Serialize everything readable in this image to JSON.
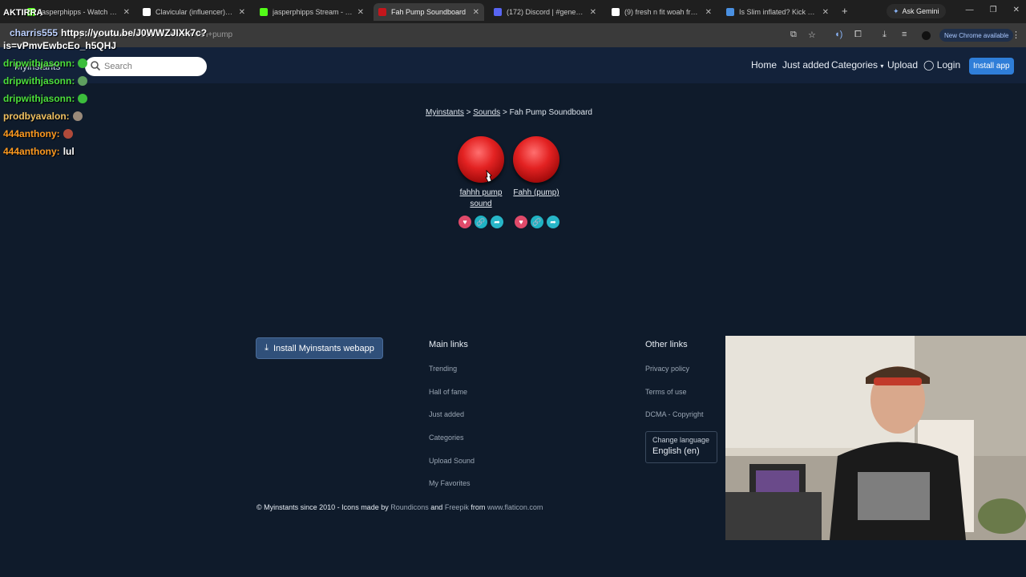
{
  "browser": {
    "tabs": [
      {
        "title": "jasperphipps - Watch the V",
        "color": "#53fc18"
      },
      {
        "title": "Clavicular (influencer) - Wik",
        "color": "#ffffff"
      },
      {
        "title": "jasperphipps Stream - Watc",
        "color": "#53fc18"
      },
      {
        "title": "Fah Pump Soundboard",
        "color": "#c4161c"
      },
      {
        "title": "(172) Discord | #general | M",
        "color": "#5865f2"
      },
      {
        "title": "(9) fresh n fit woah fresh or",
        "color": "#ffffff"
      },
      {
        "title": "Is Slim inflated? Kick engag",
        "color": "#4a90e2"
      }
    ],
    "new_tab": "+",
    "gemini": "Ask Gemini",
    "url": "myinstants.com/en/search/?name=fah+pump",
    "new_chrome": "New Chrome available"
  },
  "overlay": {
    "channel": "AKTIRRA",
    "link_user": "charris555",
    "link_text": "https://youtu.be/J0WWZJIXk7c?",
    "link_cont": "is=vPmvEwbcEo_h5QHJ",
    "messages": [
      {
        "user": "dripwithjasonn:",
        "color": "#4cdf3b",
        "msg": ""
      },
      {
        "user": "dripwithjasonn:",
        "color": "#4cdf3b",
        "msg": ""
      },
      {
        "user": "dripwithjasonn:",
        "color": "#4cdf3b",
        "msg": ""
      },
      {
        "user": "prodbyavalon:",
        "color": "#f0c060",
        "msg": ""
      },
      {
        "user": "444anthony:",
        "color": "#ff9a1f",
        "msg": ""
      },
      {
        "user": "444anthony:",
        "color": "#ff9a1f",
        "msg": "lul"
      }
    ]
  },
  "site": {
    "brand": "Myinstants",
    "search_placeholder": "Search",
    "nav": {
      "home": "Home",
      "just_added": "Just added",
      "categories": "Categories",
      "upload": "Upload",
      "login": "Login",
      "install_app": "Install app"
    },
    "breadcrumb": {
      "home": "Myinstants",
      "sep": ">",
      "sounds": "Sounds",
      "current": "Fah Pump Soundboard"
    },
    "sounds": [
      {
        "label": "fahhh pump sound"
      },
      {
        "label": "Fahh (pump)"
      }
    ],
    "footer": {
      "install_webapp": "Install Myinstants webapp",
      "main_links_title": "Main links",
      "main_links": [
        "Trending",
        "Hall of fame",
        "Just added",
        "Categories",
        "Upload Sound",
        "My Favorites"
      ],
      "other_links_title": "Other links",
      "other_links": [
        "Privacy policy",
        "Terms of use",
        "DCMA - Copyright"
      ],
      "change_language": "Change language",
      "language": "English (en)",
      "copyright_prefix": "© Myinstants since 2010 - Icons made by",
      "roundicons": "Roundicons",
      "and": "and",
      "freepik": "Freepik",
      "from": "from",
      "flaticon": "www.flaticon.com"
    }
  }
}
